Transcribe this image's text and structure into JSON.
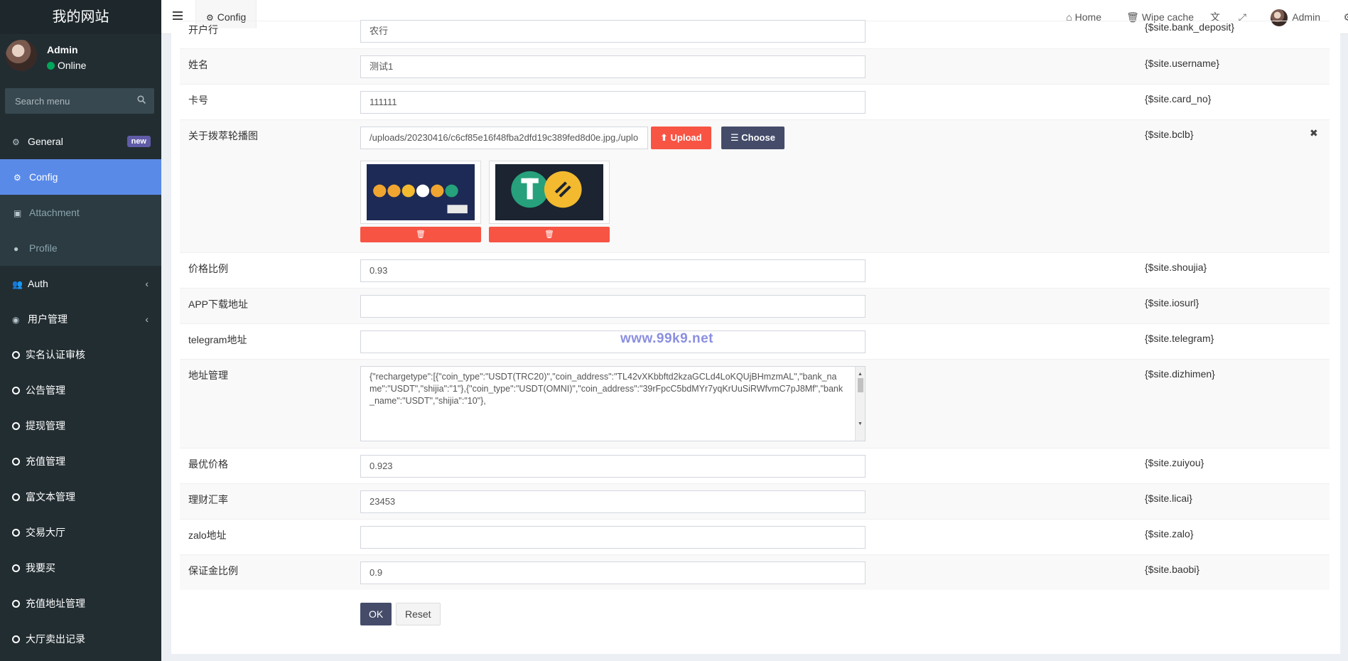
{
  "site": {
    "title": "我的网站"
  },
  "user": {
    "name": "Admin",
    "status": "Online"
  },
  "search": {
    "placeholder": "Search menu"
  },
  "menu": {
    "general": {
      "label": "General",
      "badge": "new"
    },
    "sub": [
      {
        "label": "Config",
        "icon": "gear-icon",
        "active": true
      },
      {
        "label": "Attachment",
        "icon": "image-icon"
      },
      {
        "label": "Profile",
        "icon": "user-icon"
      }
    ],
    "auth": "Auth",
    "user_mgmt": "用户管理",
    "items": [
      "实名认证审核",
      "公告管理",
      "提现管理",
      "充值管理",
      "富文本管理",
      "交易大厅",
      "我要买",
      "充值地址管理",
      "大厅卖出记录"
    ]
  },
  "header": {
    "tab": "Config",
    "home": "Home",
    "wipe": "Wipe cache",
    "admin": "Admin"
  },
  "form": {
    "rows": [
      {
        "label": "开户行",
        "value": "农行",
        "var": "{$site.bank_deposit}"
      },
      {
        "label": "姓名",
        "value": "测试1",
        "var": "{$site.username}"
      },
      {
        "label": "卡号",
        "value": "111111",
        "var": "{$site.card_no}"
      },
      {
        "label": "关于拨萃轮播图",
        "value": "/uploads/20230416/c6cf85e16f48fba2dfd19c389fed8d0e.jpg,/uplo",
        "var": "{$site.bclb}",
        "upload": "Upload",
        "choose": "Choose"
      },
      {
        "label": "价格比例",
        "value": "0.93",
        "var": "{$site.shoujia}"
      },
      {
        "label": "APP下载地址",
        "value": "",
        "var": "{$site.iosurl}"
      },
      {
        "label": "telegram地址",
        "value": "",
        "var": "{$site.telegram}"
      },
      {
        "label": "地址管理",
        "value": "{\"rechargetype\":[{\"coin_type\":\"USDT(TRC20)\",\"coin_address\":\"TL42vXKbbftd2kzaGCLd4LoKQUjBHmzmAL\",\"bank_name\":\"USDT\",\"shijia\":\"1\"},{\"coin_type\":\"USDT(OMNI)\",\"coin_address\":\"39rFpcC5bdMYr7yqKrUuSiRWfvmC7pJ8Mf\",\"bank_name\":\"USDT\",\"shijia\":\"10\"},",
        "var": "{$site.dizhimen}"
      },
      {
        "label": "最优价格",
        "value": "0.923",
        "var": "{$site.zuiyou}"
      },
      {
        "label": "理财汇率",
        "value": "23453",
        "var": "{$site.licai}"
      },
      {
        "label": "zalo地址",
        "value": "",
        "var": "{$site.zalo}"
      },
      {
        "label": "保证金比例",
        "value": "0.9",
        "var": "{$site.baobi}"
      }
    ],
    "ok": "OK",
    "reset": "Reset"
  },
  "watermark": "www.99k9.net",
  "colors": {
    "sidebar": "#222d32",
    "active": "#5a8ae8",
    "danger": "#f75444",
    "primary": "#444c69",
    "badge": "#605ca8"
  }
}
